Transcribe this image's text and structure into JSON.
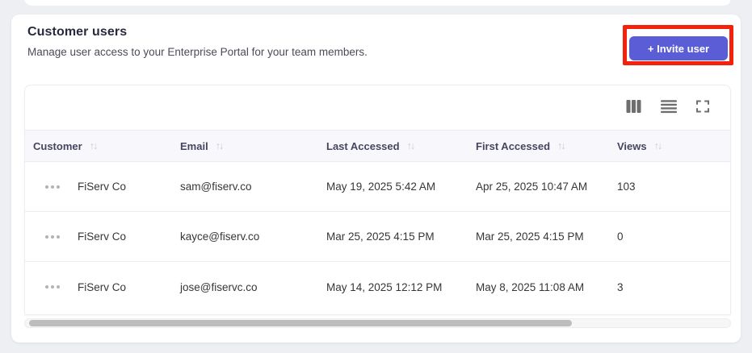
{
  "panel": {
    "title": "Customer users",
    "subtitle": "Manage user access to your Enterprise Portal for your team members.",
    "invite_button": "+ Invite user"
  },
  "icons": {
    "sort_asc": "↑",
    "sort_desc": "↓"
  },
  "table": {
    "columns": [
      {
        "label": "Customer"
      },
      {
        "label": "Email"
      },
      {
        "label": "Last Accessed"
      },
      {
        "label": "First Accessed"
      },
      {
        "label": "Views"
      }
    ],
    "rows": [
      {
        "customer": "FiServ Co",
        "email": "sam@fiserv.co",
        "last_accessed": "May 19, 2025 5:42 AM",
        "first_accessed": "Apr 25, 2025 10:47 AM",
        "views": "103"
      },
      {
        "customer": "FiServ Co",
        "email": "kayce@fiserv.co",
        "last_accessed": "Mar 25, 2025 4:15 PM",
        "first_accessed": "Mar 25, 2025 4:15 PM",
        "views": "0"
      },
      {
        "customer": "FiServ Co",
        "email": "jose@fiservc.co",
        "last_accessed": "May 14, 2025 12:12 PM",
        "first_accessed": "May 8, 2025 11:08 AM",
        "views": "3"
      }
    ]
  },
  "colors": {
    "page-bg": "#edeff3",
    "accent": "#5a5dd6",
    "annotation": "#f5220b",
    "header-bg": "#f8f8fc",
    "border": "#ececf2",
    "scroll-thumb": "#bdbdbd"
  }
}
